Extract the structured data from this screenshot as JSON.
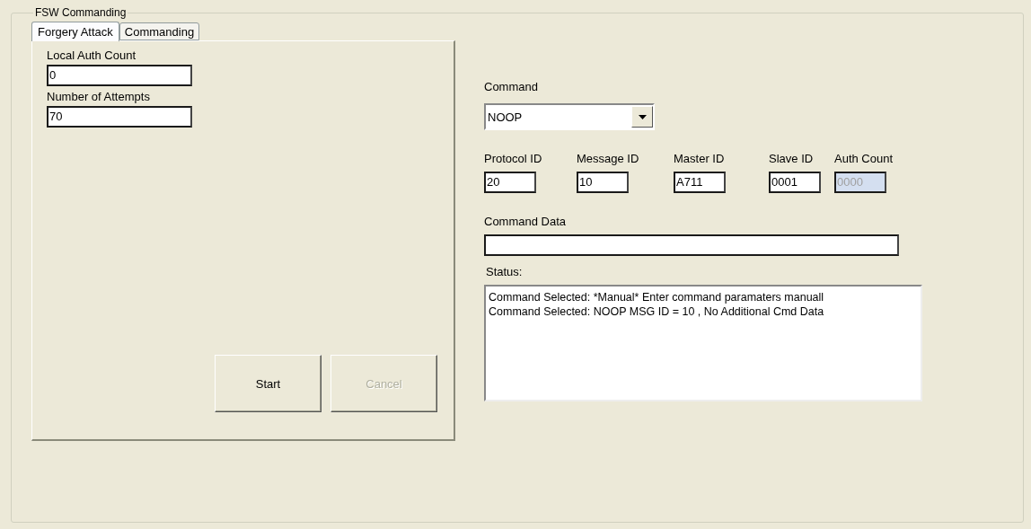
{
  "group": {
    "title": "FSW Commanding"
  },
  "tabs": [
    {
      "label": "Forgery Attack",
      "selected": true
    },
    {
      "label": "Commanding",
      "selected": false
    }
  ],
  "forgery": {
    "fields": [
      {
        "label": "Local Auth Count",
        "value": "0"
      },
      {
        "label": "Number of Attempts",
        "value": "70"
      }
    ],
    "buttons": [
      {
        "label": "Start",
        "disabled": false
      },
      {
        "label": "Cancel",
        "disabled": true
      }
    ]
  },
  "command": {
    "label": "Command",
    "value": "NOOP"
  },
  "ids": [
    {
      "label": "Protocol ID",
      "value": "20",
      "disabled": false
    },
    {
      "label": "Message ID",
      "value": "10",
      "disabled": false
    },
    {
      "label": "Master ID",
      "value": "A711",
      "disabled": false
    },
    {
      "label": "Slave ID",
      "value": "0001",
      "disabled": false
    },
    {
      "label": "Auth Count",
      "value": "0000",
      "disabled": true
    }
  ],
  "command_data": {
    "label": "Command Data"
  },
  "status": {
    "label": "Status:",
    "lines": [
      "Command Selected: *Manual* Enter command paramaters manuall",
      "Command Selected: NOOP MSG ID = 10 , No Additional Cmd Data"
    ]
  }
}
